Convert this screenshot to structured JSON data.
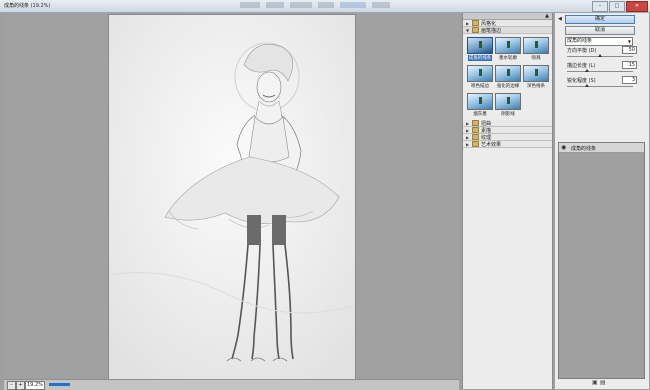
{
  "window": {
    "title": "成角的线条 (19.2%)",
    "buttons": {
      "minimize": "–",
      "maximize": "□",
      "close": "✕"
    }
  },
  "status": {
    "zoom": "19.2%",
    "minus": "–",
    "plus": "+",
    "progress": 0.35
  },
  "filter_gallery": {
    "categories": [
      {
        "label": "风格化",
        "open": false
      },
      {
        "label": "画笔描边",
        "open": true
      },
      {
        "label": "扭曲",
        "open": false
      },
      {
        "label": "素描",
        "open": false
      },
      {
        "label": "纹理",
        "open": false
      },
      {
        "label": "艺术效果",
        "open": false
      }
    ],
    "thumbnails": [
      {
        "label": "成角的线条",
        "selected": true
      },
      {
        "label": "墨水轮廓",
        "selected": false
      },
      {
        "label": "喷溅",
        "selected": false
      },
      {
        "label": "喷色描边",
        "selected": false
      },
      {
        "label": "强化的边缘",
        "selected": false
      },
      {
        "label": "深色线条",
        "selected": false
      },
      {
        "label": "烟灰墨",
        "selected": false
      },
      {
        "label": "阴影线",
        "selected": false
      }
    ]
  },
  "settings": {
    "ok_label": "确定",
    "cancel_label": "取消",
    "filter_select": "成角的线条",
    "params": [
      {
        "label": "方向平衡 (D)",
        "value": "50",
        "fraction": 0.5
      },
      {
        "label": "描边长度 (L)",
        "value": "15",
        "fraction": 0.3
      },
      {
        "label": "锐化程度 (S)",
        "value": "3",
        "fraction": 0.3
      }
    ]
  },
  "layers": {
    "items": [
      {
        "label": "成角的线条"
      }
    ]
  },
  "colors": {
    "accent": "#356fb9",
    "canvas": "#a1a1a1",
    "panel": "#ececec"
  }
}
